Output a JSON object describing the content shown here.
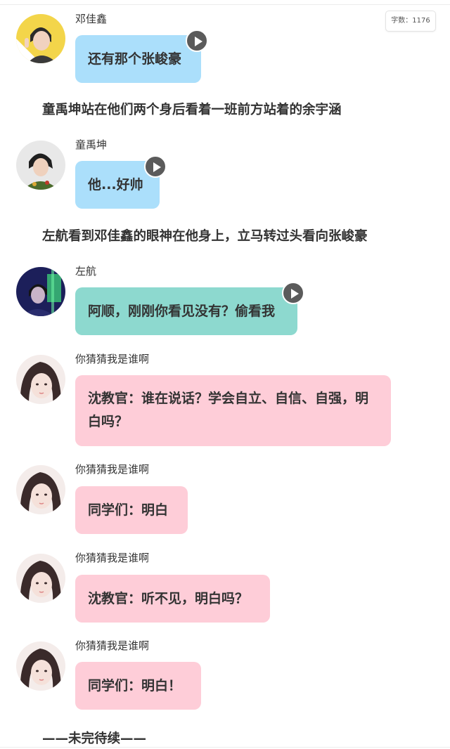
{
  "word_count": "字数：1176",
  "messages": [
    {
      "name": "邓佳鑫",
      "text": "还有那个张峻豪",
      "color": "#abdffb",
      "avatar": "avatar-deng-jiaxin",
      "voice": true
    },
    {
      "name": "童禹坤",
      "text": "他...好帅",
      "color": "#abdffb",
      "avatar": "avatar-tong-yukun",
      "voice": true
    },
    {
      "name": "左航",
      "text": "阿顺，刚刚你看见没有？偷看我",
      "color": "#8dd9cf",
      "avatar": "avatar-zuo-hang",
      "voice": true
    },
    {
      "name": "你猜猜我是谁啊",
      "line1": "沈教官：谁在说话？学会自立、自信、自强，明",
      "line2": "白吗？",
      "color": "#fecdd8",
      "avatar": "avatar-narrator-girl"
    },
    {
      "name": "你猜猜我是谁啊",
      "text": "同学们：明白",
      "color": "#fecdd8",
      "avatar": "avatar-narrator-girl"
    },
    {
      "name": "你猜猜我是谁啊",
      "text": "沈教官：听不见，明白吗？",
      "color": "#fecdd8",
      "avatar": "avatar-narrator-girl"
    },
    {
      "name": "你猜猜我是谁啊",
      "text": "同学们：明白！",
      "color": "#fecdd8",
      "avatar": "avatar-narrator-girl"
    }
  ],
  "narrations": [
    "童禹坤站在他们两个身后看着一班前方站着的余宇涵",
    "左航看到邓佳鑫的眼神在他身上，立马转过头看向张峻豪",
    "——未完待续——"
  ]
}
